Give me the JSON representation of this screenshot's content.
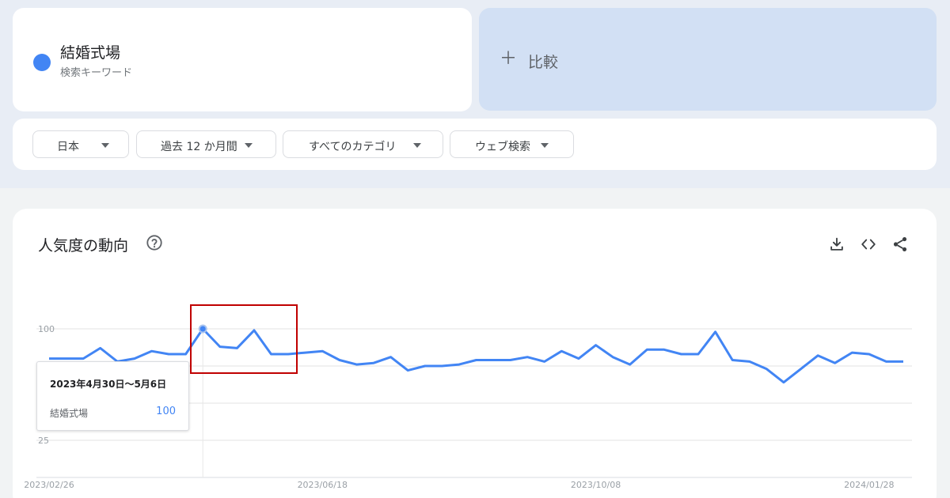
{
  "term": {
    "title": "結婚式場",
    "subtitle": "検索キーワード",
    "color": "#4285f4"
  },
  "compare": {
    "label": "比較"
  },
  "filters": [
    {
      "label": "日本"
    },
    {
      "label": "過去 12 か月間"
    },
    {
      "label": "すべてのカテゴリ"
    },
    {
      "label": "ウェブ検索"
    }
  ],
  "chart_section": {
    "title": "人気度の動向",
    "icons": [
      "help-icon",
      "download-icon",
      "embed-code-icon",
      "share-icon"
    ]
  },
  "tooltip": {
    "date": "2023年4月30日～5月6日",
    "term": "結婚式場",
    "value": "100"
  },
  "chart_data": {
    "type": "line",
    "series": [
      {
        "name": "結婚式場",
        "color": "#4285f4",
        "values": [
          80,
          80,
          80,
          87,
          78,
          80,
          85,
          83,
          83,
          100,
          88,
          87,
          99,
          83,
          83,
          84,
          85,
          79,
          76,
          77,
          81,
          72,
          75,
          75,
          76,
          79,
          79,
          79,
          81,
          78,
          85,
          80,
          89,
          81,
          76,
          86,
          86,
          83,
          83,
          98,
          79,
          78,
          73,
          64,
          73,
          82,
          77,
          84,
          83,
          78,
          78
        ]
      }
    ],
    "x_tick_labels": [
      "2023/02/26",
      "2023/06/18",
      "2023/10/08",
      "2024/01/28"
    ],
    "x_tick_indices": [
      0,
      16,
      32,
      48
    ],
    "y_tick_labels": [
      "100",
      "25"
    ],
    "y_tick_values": [
      100,
      25
    ],
    "ylim": [
      0,
      100
    ],
    "grid": true,
    "hover_index": 9
  }
}
